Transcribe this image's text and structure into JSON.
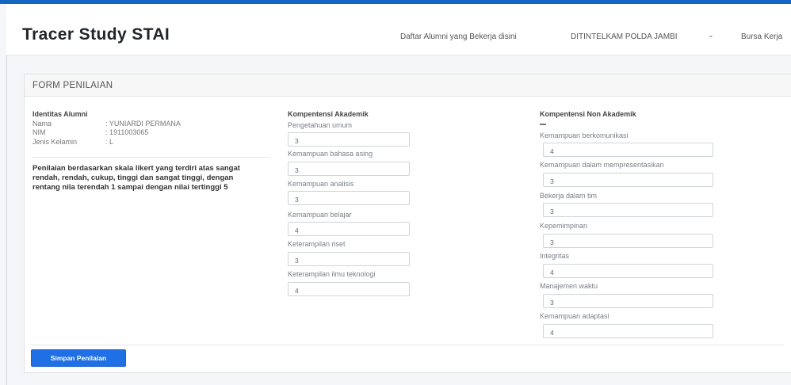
{
  "header": {
    "brand": "Tracer Study STAI",
    "nav_links": [
      "Daftar Alumni yang Bekerja disini",
      "DITINTELKAM POLDA JAMBI",
      "Bursa Kerja"
    ]
  },
  "form": {
    "title": "FORM PENILAIAN",
    "identitas": {
      "title": "Identitas Alumni",
      "rows": [
        {
          "label": "Nama",
          "value": ": YUNIARDI PERMANA"
        },
        {
          "label": "NIM",
          "value": ": 1911003065"
        },
        {
          "label": "Jenis Kelamin",
          "value": ": L"
        }
      ]
    },
    "note": "Penilaian berdasarkan skala likert yang terdiri atas sangat rendah, rendah, cukup, tinggi dan sangat tinggi, dengan rentang nila terendah 1 sampai dengan nilai tertinggi 5",
    "akademik": {
      "title": "Kompentensi Akademik",
      "fields": [
        {
          "label": "Pengetahuan umum",
          "value": "3"
        },
        {
          "label": "Kemampuan bahasa asing",
          "value": "3"
        },
        {
          "label": "Kemampuan analisis",
          "value": "3"
        },
        {
          "label": "Kemampuan belajar",
          "value": "4"
        },
        {
          "label": "Keterampilan riset",
          "value": "3"
        },
        {
          "label": "Keterampilan ilmu teknologi",
          "value": "4"
        }
      ]
    },
    "non_akademik": {
      "title": "Kompentensi Non Akademik",
      "fields": [
        {
          "label": "Kemampuan berkomunikasi",
          "value": "4"
        },
        {
          "label": "Kemampuan dalam mempresentasikan",
          "value": "3"
        },
        {
          "label": "Bekerja dalam tim",
          "value": "3"
        },
        {
          "label": "Kepemimpinan",
          "value": "3"
        },
        {
          "label": "Integritas",
          "value": "4"
        },
        {
          "label": "Manajemen waktu",
          "value": "3"
        },
        {
          "label": "Kemampuan adaptasi",
          "value": "4"
        }
      ]
    },
    "submit_label": "Simpan Penilaian"
  }
}
